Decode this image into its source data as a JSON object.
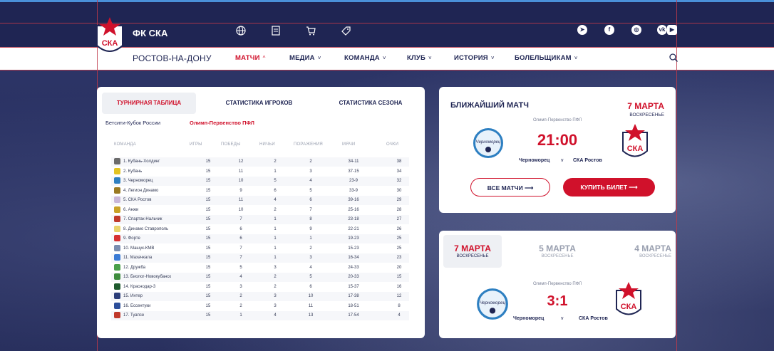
{
  "header": {
    "brand": "ФК СКА",
    "city": "РОСТОВ-НА-ДОНУ",
    "logo_text": "СКА",
    "top_icons": [
      "globe-icon",
      "document-icon",
      "cart-icon",
      "ticket-icon"
    ],
    "social_icons": [
      "telegram-icon",
      "facebook-icon",
      "instagram-icon",
      "vk-icon",
      "youtube-icon"
    ]
  },
  "nav": {
    "items": [
      {
        "label": "МАТЧИ",
        "active": true
      },
      {
        "label": "МЕДИА",
        "active": false
      },
      {
        "label": "КОМАНДА",
        "active": false
      },
      {
        "label": "КЛУБ",
        "active": false
      },
      {
        "label": "ИСТОРИЯ",
        "active": false
      },
      {
        "label": "БОЛЕЛЬЩИКАМ",
        "active": false
      }
    ]
  },
  "standings": {
    "tabs": [
      "ТУРНИРНАЯ ТАБЛИЦА",
      "СТАТИСТИКА ИГРОКОВ",
      "СТАТИСТИКА СЕЗОНА"
    ],
    "subtabs": [
      "Бетсити-Кубок России",
      "Олимп-Первенство ПФЛ"
    ],
    "columns": [
      "КОМАНДА",
      "ИГРЫ",
      "ПОБЕДЫ",
      "НИЧЬИ",
      "ПОРАЖЕНИЯ",
      "МЯЧИ",
      "ОЧКИ"
    ],
    "rows": [
      {
        "team": "1. Кубань-Холдинг",
        "games": "15",
        "wins": "12",
        "draws": "2",
        "losses": "2",
        "goals": "34-11",
        "points": "38",
        "color": "#6b6b6b"
      },
      {
        "team": "2. Кубань",
        "games": "15",
        "wins": "11",
        "draws": "1",
        "losses": "3",
        "goals": "37-15",
        "points": "34",
        "color": "#e2c322"
      },
      {
        "team": "3. Черноморец",
        "games": "15",
        "wins": "10",
        "draws": "5",
        "losses": "4",
        "goals": "23-9",
        "points": "32",
        "color": "#2d7fc1"
      },
      {
        "team": "4. Легион Динамо",
        "games": "15",
        "wins": "9",
        "draws": "6",
        "losses": "5",
        "goals": "33-9",
        "points": "30",
        "color": "#9a7a22"
      },
      {
        "team": "5. СКА Ростов",
        "games": "15",
        "wins": "11",
        "draws": "4",
        "losses": "6",
        "goals": "39-16",
        "points": "29",
        "color": "#c9b7d9"
      },
      {
        "team": "6. Анжи",
        "games": "15",
        "wins": "10",
        "draws": "2",
        "losses": "7",
        "goals": "25-16",
        "points": "28",
        "color": "#c9a227"
      },
      {
        "team": "7. Спартак-Нальчик",
        "games": "15",
        "wins": "7",
        "draws": "1",
        "losses": "8",
        "goals": "23-18",
        "points": "27",
        "color": "#c0392b"
      },
      {
        "team": "8. Динамо Ставрополь",
        "games": "15",
        "wins": "6",
        "draws": "1",
        "losses": "9",
        "goals": "22-21",
        "points": "26",
        "color": "#e8d36b"
      },
      {
        "team": "9. Форте",
        "games": "15",
        "wins": "6",
        "draws": "1",
        "losses": "1",
        "goals": "19-23",
        "points": "25",
        "color": "#d63031"
      },
      {
        "team": "10. Машук-КМВ",
        "games": "15",
        "wins": "7",
        "draws": "1",
        "losses": "2",
        "goals": "15-23",
        "points": "25",
        "color": "#7a8db0"
      },
      {
        "team": "11. Махачкала",
        "games": "15",
        "wins": "7",
        "draws": "1",
        "losses": "3",
        "goals": "16-34",
        "points": "23",
        "color": "#3a7bd5"
      },
      {
        "team": "12. Дружба",
        "games": "15",
        "wins": "5",
        "draws": "3",
        "losses": "4",
        "goals": "24-33",
        "points": "20",
        "color": "#4aa04a"
      },
      {
        "team": "13. Биолог-Новокубанск",
        "games": "15",
        "wins": "4",
        "draws": "2",
        "losses": "5",
        "goals": "20-33",
        "points": "15",
        "color": "#3d8b3d"
      },
      {
        "team": "14. Краснодар-3",
        "games": "15",
        "wins": "3",
        "draws": "2",
        "losses": "6",
        "goals": "15-37",
        "points": "16",
        "color": "#1e5a2e"
      },
      {
        "team": "15. Интер",
        "games": "15",
        "wins": "2",
        "draws": "3",
        "losses": "10",
        "goals": "17-38",
        "points": "12",
        "color": "#2c3e7a"
      },
      {
        "team": "16. Ессентуки",
        "games": "15",
        "wins": "2",
        "draws": "3",
        "losses": "11",
        "goals": "18-51",
        "points": "8",
        "color": "#2c4e9a"
      },
      {
        "team": "17. Туапсе",
        "games": "15",
        "wins": "1",
        "draws": "4",
        "losses": "13",
        "goals": "17-54",
        "points": "4",
        "color": "#c0392b"
      }
    ]
  },
  "next_match": {
    "title": "БЛИЖАЙШИЙ МАТЧ",
    "date": "7 МАРТА",
    "weekday": "ВОСКРЕСЕНЬЕ",
    "tournament": "Олимп-Первенство ПФЛ",
    "time": "21:00",
    "home": "Черноморец",
    "vs": "v",
    "away": "СКА Ростов",
    "home_logo_text": "Черноморец",
    "away_logo_text": "СКА",
    "all_matches_label": "ВСЕ МАТЧИ",
    "buy_ticket_label": "КУПИТЬ БИЛЕТ"
  },
  "results": {
    "dates": [
      {
        "date": "7 МАРТА",
        "weekday": "ВОСКРЕСЕНЬЕ",
        "active": true
      },
      {
        "date": "5 МАРТА",
        "weekday": "ВОСКРЕСЕНЬЕ",
        "active": false
      },
      {
        "date": "4 МАРТА",
        "weekday": "ВОСКРЕСЕНЬЕ",
        "active": false
      }
    ],
    "tournament": "Олимп-Первенство ПФЛ",
    "score": "3:1",
    "home": "Черноморец",
    "vs": "v",
    "away": "СКА Ростов",
    "home_logo_text": "Черноморец",
    "away_logo_text": "СКА"
  }
}
